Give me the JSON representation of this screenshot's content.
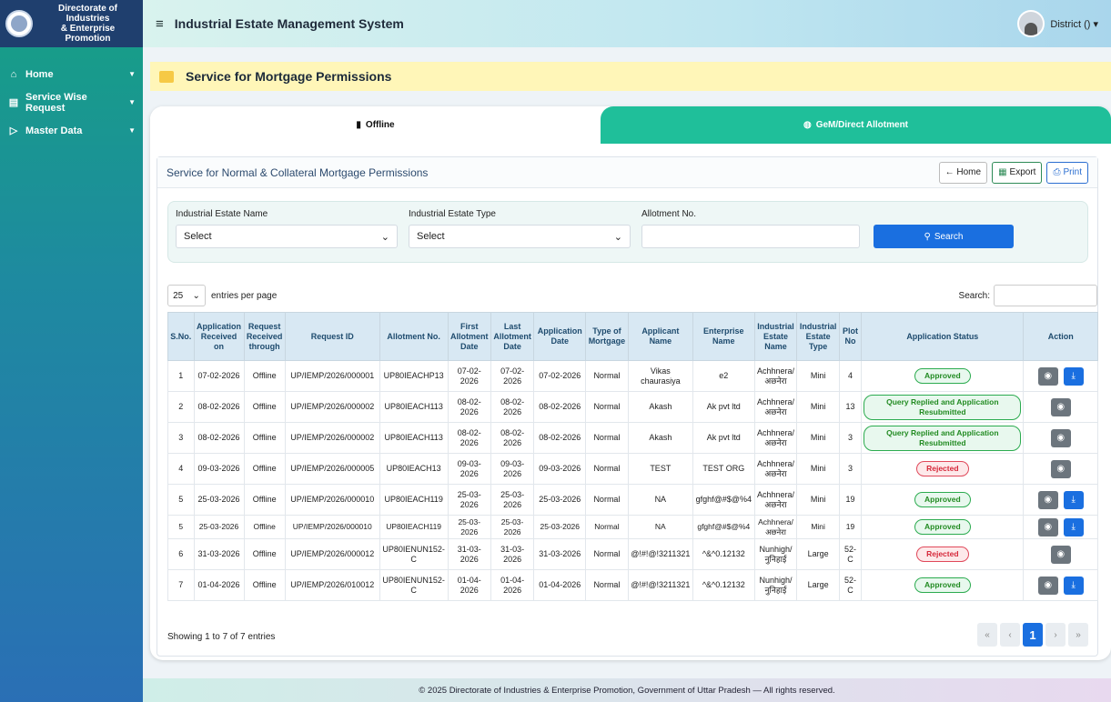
{
  "brand": {
    "org_line1": "Directorate of Industries",
    "org_line2": "& Enterprise Promotion"
  },
  "sidebar": {
    "items": [
      {
        "label": "Home",
        "icon": "home-icon"
      },
      {
        "label": "Service Wise Request",
        "icon": "list-icon"
      },
      {
        "label": "Master Data",
        "icon": "database-icon"
      }
    ]
  },
  "topbar": {
    "title": "Industrial Estate Management System",
    "user": "District () ▾"
  },
  "page": {
    "title": "Service for Mortgage Permissions"
  },
  "tabs": {
    "offline": "Offline",
    "gem": "GeM/Direct Allotment"
  },
  "panel": {
    "title": "Service for Normal & Collateral Mortgage Permissions",
    "home": "← Home",
    "export": "Export",
    "print": "Print"
  },
  "filters": {
    "estate_name_label": "Industrial Estate Name",
    "estate_name_value": "Select",
    "estate_type_label": "Industrial Estate Type",
    "estate_type_value": "Select",
    "allotment_label": "Allotment No.",
    "allotment_value": "",
    "search": "Search"
  },
  "table_controls": {
    "per_page": "25",
    "entries_label": "entries per page",
    "search_label": "Search:"
  },
  "columns": [
    "S.No.",
    "Application Received on",
    "Request Received through",
    "Request ID",
    "Allotment No.",
    "First Allotment Date",
    "Last Allotment Date",
    "Application Date",
    "Type of Mortgage",
    "Applicant Name",
    "Enterprise Name",
    "Industrial Estate Name",
    "Industrial Estate Type",
    "Plot No",
    "Application Status",
    "Action"
  ],
  "rows": [
    [
      "1",
      "07-02-2026",
      "Offline",
      "UP/IEMP/2026/000001",
      "UP80IEACHP13",
      "07-02-2026",
      "07-02-2026",
      "07-02-2026",
      "Normal",
      "Vikas chaurasiya",
      "e2",
      "Achhnera/ अछनेरा",
      "Mini",
      "4",
      "Approved",
      "view,dl"
    ],
    [
      "2",
      "08-02-2026",
      "Offline",
      "UP/IEMP/2026/000002",
      "UP80IEACH113",
      "08-02-2026",
      "08-02-2026",
      "08-02-2026",
      "Normal",
      "Akash",
      "Ak pvt ltd",
      "Achhnera/ अछनेरा",
      "Mini",
      "13",
      "Query Replied and Application Resubmitted",
      "view"
    ],
    [
      "3",
      "08-02-2026",
      "Offline",
      "UP/IEMP/2026/000002",
      "UP80IEACH113",
      "08-02-2026",
      "08-02-2026",
      "08-02-2026",
      "Normal",
      "Akash",
      "Ak pvt ltd",
      "Achhnera/ अछनेरा",
      "Mini",
      "3",
      "Query Replied and Application Resubmitted",
      "view"
    ],
    [
      "4",
      "09-03-2026",
      "Offline",
      "UP/IEMP/2026/000005",
      "UP80IEACH13",
      "09-03-2026",
      "09-03-2026",
      "09-03-2026",
      "Normal",
      "TEST",
      "TEST ORG",
      "Achhnera/ अछनेरा",
      "Mini",
      "3",
      "Rejected",
      "view"
    ],
    [
      "5",
      "25-03-2026",
      "Offline",
      "UP/IEMP/2026/000010",
      "UP80IEACH119",
      "25-03-2026",
      "25-03-2026",
      "25-03-2026",
      "Normal",
      "NA",
      "gfghf@#$@%4",
      "Achhnera/ अछनेरा",
      "Mini",
      "19",
      "Approved",
      "view,dl"
    ],
    [
      "5",
      "25-03-2026",
      "Offline",
      "UP/IEMP/2026/000010",
      "UP80IEACH119",
      "25-03-2026",
      "25-03-2026",
      "25-03-2026",
      "Normal",
      "NA",
      "gfghf@#$@%4",
      "Achhnera/ अछनेरा",
      "Mini",
      "19",
      "Approved",
      "view,dl"
    ],
    [
      "6",
      "31-03-2026",
      "Offline",
      "UP/IEMP/2026/000012",
      "UP80IENUN152-C",
      "31-03-2026",
      "31-03-2026",
      "31-03-2026",
      "Normal",
      "@!#!@!3211321",
      "^&^0.12132",
      "Nunhigh/ नुनिहाई",
      "Large",
      "52-C",
      "Rejected",
      "view"
    ],
    [
      "7",
      "01-04-2026",
      "Offline",
      "UP/IEMP/2026/010012",
      "UP80IENUN152-C",
      "01-04-2026",
      "01-04-2026",
      "01-04-2026",
      "Normal",
      "@!#!@!3211321",
      "^&^0.12132",
      "Nunhigh/ नुनिहाई",
      "Large",
      "52-C",
      "Approved",
      "view,dl"
    ]
  ],
  "footer_info": "Showing 1 to 7 of 7 entries",
  "pager": [
    "«",
    "‹",
    "1",
    "›",
    "»"
  ],
  "footer": "© 2025 Directorate of Industries & Enterprise Promotion, Government of Uttar Pradesh — All rights reserved."
}
